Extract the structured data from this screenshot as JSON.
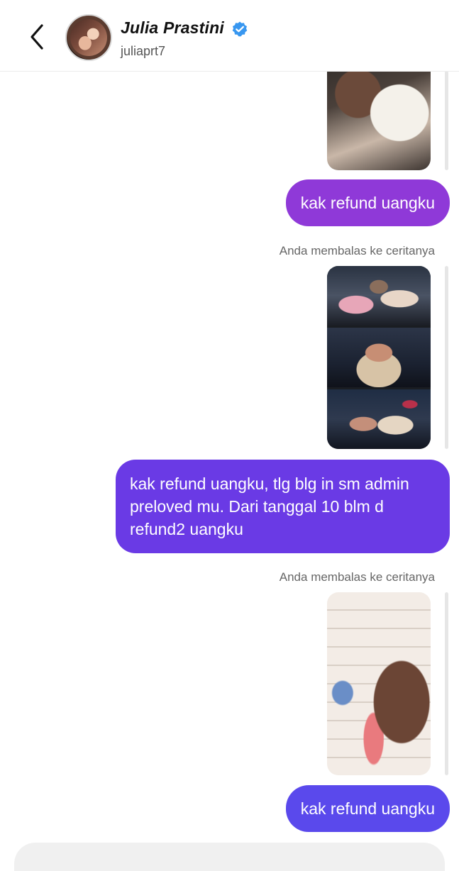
{
  "header": {
    "name": "Julia Prastini",
    "username": "juliaprt7",
    "verified": true,
    "icons": {
      "back": "chevron-left-icon",
      "verified": "verified-badge-icon"
    },
    "colors": {
      "verified": "#3897f0"
    }
  },
  "messages": [
    {
      "type": "story-reply-image",
      "sender": "me"
    },
    {
      "type": "text",
      "sender": "me",
      "text": "kak refund uangku",
      "color": "#8f39d8"
    },
    {
      "type": "label",
      "text": "Anda membalas ke ceritanya"
    },
    {
      "type": "story-reply-image",
      "sender": "me"
    },
    {
      "type": "text",
      "sender": "me",
      "text": "kak refund uangku, tlg blg in sm admin preloved mu. Dari tanggal 10 blm d refund2 uangku",
      "color": "#6a3ae5"
    },
    {
      "type": "label",
      "text": "Anda membalas ke ceritanya"
    },
    {
      "type": "story-reply-image",
      "sender": "me"
    },
    {
      "type": "text",
      "sender": "me",
      "text": "kak refund uangku",
      "color": "#5a49ec"
    }
  ]
}
